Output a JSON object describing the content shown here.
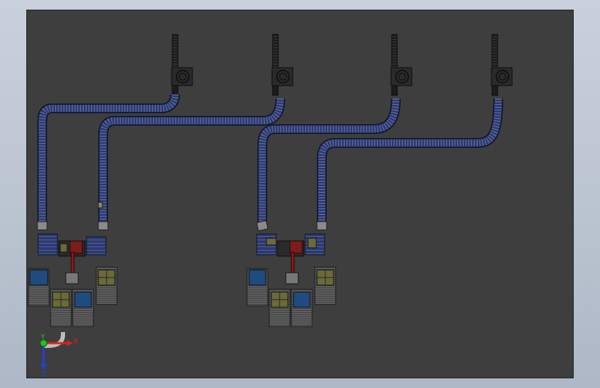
{
  "viewport": {
    "background": "#3e3e3e"
  },
  "colors": {
    "conveyor_fill": "#2d3a70",
    "conveyor_edge": "#0e1222",
    "conveyor_rail": "#6a79b0",
    "rack_blue": "#1f4b7e",
    "rack_frame": "#555555",
    "pallet_tan": "#6b6a3a",
    "robot_red": "#8b1a1a",
    "infeed_dark": "#2a2a2a",
    "axis_x": "#e02020",
    "axis_y": "#20c020",
    "axis_z": "#2040e0"
  },
  "triad": {
    "x_label": "X",
    "y_label": "Y",
    "z_label": "Z",
    "x_icon": "x-axis-arrow",
    "y_icon": "y-axis-ball",
    "z_icon": "z-axis-arrow"
  },
  "layout_summary": {
    "infeed_lines": 4,
    "palletizing_cells": 2
  }
}
